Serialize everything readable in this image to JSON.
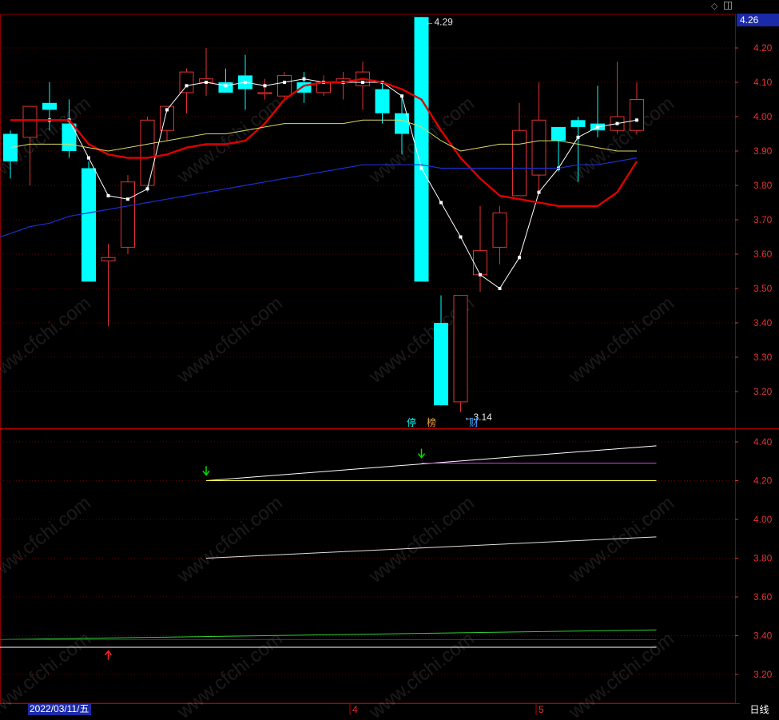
{
  "header": {
    "current_price": "4.26"
  },
  "footer": {
    "date_label": "2022/03/11/五",
    "month_labels": [
      "4",
      "5"
    ],
    "period_button": "日线"
  },
  "icons": {
    "top_diamond": "diamond-icon",
    "top_toggle": "panel-toggle-icon",
    "up_arrow": "red-up-arrow-icon",
    "down_arrow": "green-down-arrow-icon"
  },
  "watermark": "www.cfchi.com",
  "colors": {
    "up": "#e23232",
    "down": "#00ffff",
    "ma5": "#ffffff",
    "ma10": "#e00000",
    "ma20": "#d8d86a",
    "ma60": "#1c2fd0",
    "axis": "#e23232",
    "grid": "#6a0000"
  },
  "chart_data": [
    {
      "type": "candlestick",
      "ylim": [
        3.1,
        4.3
      ],
      "yticks": [
        "4.20",
        "4.10",
        "4.00",
        "3.90",
        "3.80",
        "3.70",
        "3.60",
        "3.50",
        "3.40",
        "3.30",
        "3.20"
      ],
      "candles": [
        {
          "open": 3.95,
          "high": 3.96,
          "low": 3.82,
          "close": 3.87
        },
        {
          "open": 3.94,
          "high": 4.03,
          "low": 3.8,
          "close": 4.03
        },
        {
          "open": 4.04,
          "high": 4.1,
          "low": 3.96,
          "close": 4.02
        },
        {
          "open": 3.98,
          "high": 4.05,
          "low": 3.88,
          "close": 3.9
        },
        {
          "open": 3.85,
          "high": 3.87,
          "low": 3.52,
          "close": 3.52
        },
        {
          "open": 3.58,
          "high": 3.63,
          "low": 3.39,
          "close": 3.59
        },
        {
          "open": 3.62,
          "high": 3.83,
          "low": 3.6,
          "close": 3.81
        },
        {
          "open": 3.8,
          "high": 4.0,
          "low": 3.78,
          "close": 3.99
        },
        {
          "open": 3.96,
          "high": 4.03,
          "low": 3.93,
          "close": 4.03
        },
        {
          "open": 4.07,
          "high": 4.14,
          "low": 4.01,
          "close": 4.13
        },
        {
          "open": 4.1,
          "high": 4.2,
          "low": 4.06,
          "close": 4.11
        },
        {
          "open": 4.1,
          "high": 4.14,
          "low": 4.07,
          "close": 4.07
        },
        {
          "open": 4.12,
          "high": 4.18,
          "low": 4.02,
          "close": 4.08
        },
        {
          "open": 4.07,
          "high": 4.11,
          "low": 4.05,
          "close": 4.07
        },
        {
          "open": 4.06,
          "high": 4.13,
          "low": 4.05,
          "close": 4.12
        },
        {
          "open": 4.1,
          "high": 4.13,
          "low": 4.04,
          "close": 4.07
        },
        {
          "open": 4.07,
          "high": 4.12,
          "low": 4.06,
          "close": 4.1
        },
        {
          "open": 4.1,
          "high": 4.13,
          "low": 4.05,
          "close": 4.11
        },
        {
          "open": 4.09,
          "high": 4.16,
          "low": 4.02,
          "close": 4.13
        },
        {
          "open": 4.08,
          "high": 4.1,
          "low": 3.98,
          "close": 4.01
        },
        {
          "open": 4.01,
          "high": 4.06,
          "low": 3.89,
          "close": 3.95
        },
        {
          "open": 4.29,
          "high": 4.29,
          "low": 3.52,
          "close": 3.52
        },
        {
          "open": 3.4,
          "high": 3.48,
          "low": 3.16,
          "close": 3.16
        },
        {
          "open": 3.17,
          "high": 3.48,
          "low": 3.14,
          "close": 3.48
        },
        {
          "open": 3.54,
          "high": 3.74,
          "low": 3.49,
          "close": 3.61
        },
        {
          "open": 3.62,
          "high": 3.74,
          "low": 3.57,
          "close": 3.72
        },
        {
          "open": 3.77,
          "high": 4.04,
          "low": 3.77,
          "close": 3.96
        },
        {
          "open": 3.83,
          "high": 4.1,
          "low": 3.78,
          "close": 3.99
        },
        {
          "open": 3.97,
          "high": 3.97,
          "low": 3.84,
          "close": 3.93
        },
        {
          "open": 3.99,
          "high": 4.0,
          "low": 3.81,
          "close": 3.97
        },
        {
          "open": 3.98,
          "high": 4.09,
          "low": 3.94,
          "close": 3.96
        },
        {
          "open": 3.96,
          "high": 4.16,
          "low": 3.95,
          "close": 4.0
        },
        {
          "open": 3.96,
          "high": 4.1,
          "low": 3.95,
          "close": 4.05
        }
      ],
      "series": [
        {
          "values": [
            null,
            null,
            3.99,
            3.99,
            3.88,
            3.77,
            3.76,
            3.79,
            4.02,
            4.09,
            4.1,
            4.09,
            4.1,
            4.09,
            4.1,
            4.11,
            4.1,
            4.1,
            4.1,
            4.1,
            4.06,
            3.85,
            3.75,
            3.65,
            3.54,
            3.5,
            3.59,
            3.78,
            3.85,
            3.94,
            3.97,
            3.98,
            3.99
          ]
        },
        {
          "values": [
            3.99,
            3.99,
            3.99,
            3.99,
            3.92,
            3.89,
            3.88,
            3.88,
            3.89,
            3.91,
            3.92,
            3.92,
            3.93,
            3.98,
            4.05,
            4.09,
            4.1,
            4.1,
            4.11,
            4.1,
            4.08,
            4.05,
            3.96,
            3.88,
            3.82,
            3.77,
            3.76,
            3.75,
            3.74,
            3.74,
            3.74,
            3.78,
            3.87
          ]
        },
        {
          "values": [
            3.91,
            3.92,
            3.92,
            3.92,
            3.91,
            3.9,
            3.91,
            3.92,
            3.93,
            3.94,
            3.95,
            3.95,
            3.96,
            3.97,
            3.98,
            3.98,
            3.98,
            3.98,
            3.99,
            3.99,
            3.99,
            3.97,
            3.93,
            3.9,
            3.91,
            3.92,
            3.92,
            3.93,
            3.93,
            3.92,
            3.91,
            3.9,
            3.9
          ]
        },
        {
          "values": [
            3.66,
            3.68,
            3.69,
            3.71,
            3.72,
            3.73,
            3.74,
            3.75,
            3.76,
            3.77,
            3.78,
            3.79,
            3.8,
            3.81,
            3.82,
            3.83,
            3.84,
            3.85,
            3.86,
            3.86,
            3.86,
            3.86,
            3.85,
            3.85,
            3.85,
            3.85,
            3.85,
            3.85,
            3.85,
            3.86,
            3.86,
            3.87,
            3.88
          ]
        }
      ],
      "annotations": [
        "4.29",
        "3.14"
      ],
      "tags": [
        {
          "text": "停",
          "color": "#00ffff"
        },
        {
          "text": "榜",
          "color": "#f0a040"
        },
        {
          "text": "财",
          "color": "#40a0ff"
        }
      ]
    },
    {
      "type": "line",
      "ylim": [
        3.15,
        4.44
      ],
      "yticks": [
        "4.40",
        "4.20",
        "4.00",
        "3.80",
        "3.60",
        "3.40",
        "3.20"
      ],
      "series": [
        {
          "color": "#ffffff",
          "x": [
            10,
            33
          ],
          "values": [
            4.2,
            4.38
          ]
        },
        {
          "color": "#ffff40",
          "x": [
            10,
            33
          ],
          "values": [
            4.2,
            4.2
          ]
        },
        {
          "color": "#e040e0",
          "x": [
            21,
            33
          ],
          "values": [
            4.29,
            4.29
          ]
        },
        {
          "color": "#e0e0e0",
          "x": [
            10,
            33
          ],
          "values": [
            3.8,
            3.91
          ]
        },
        {
          "color": "#30d030",
          "x": [
            0,
            33
          ],
          "values": [
            3.38,
            3.43
          ]
        },
        {
          "color": "#2030e0",
          "x": [
            0,
            33
          ],
          "values": [
            3.38,
            3.38
          ]
        },
        {
          "color": "#ffffff",
          "x": [
            0,
            33
          ],
          "values": [
            3.34,
            3.34
          ]
        }
      ],
      "markers": [
        {
          "type": "down",
          "x": 10,
          "value": 4.25
        },
        {
          "type": "down",
          "x": 21,
          "value": 4.34
        },
        {
          "type": "up",
          "x": 5,
          "value": 3.3
        }
      ]
    }
  ]
}
